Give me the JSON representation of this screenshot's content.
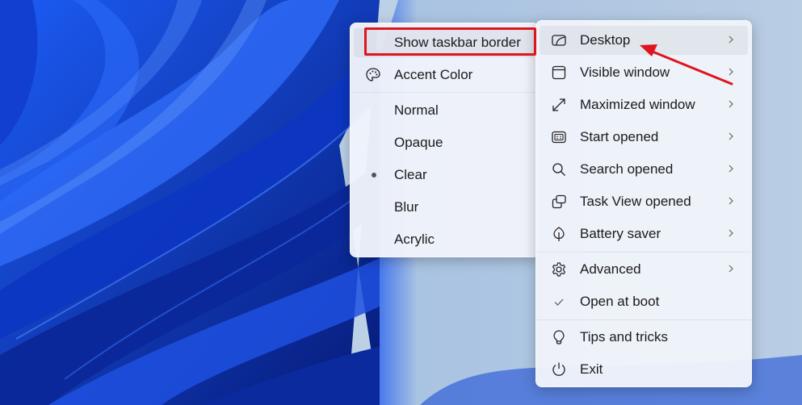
{
  "left_menu": {
    "items": [
      {
        "label": "Show taskbar border",
        "icon": "none",
        "highlighted": true
      },
      {
        "label": "Accent Color",
        "icon": "palette-icon"
      },
      {
        "label": "Normal"
      },
      {
        "label": "Opaque"
      },
      {
        "label": "Clear",
        "selected": true
      },
      {
        "label": "Blur"
      },
      {
        "label": "Acrylic"
      }
    ]
  },
  "right_menu": {
    "items": [
      {
        "label": "Desktop",
        "icon": "desktop-icon",
        "submenu": true,
        "hover": true
      },
      {
        "label": "Visible window",
        "icon": "window-icon",
        "submenu": true
      },
      {
        "label": "Maximized window",
        "icon": "maximize-icon",
        "submenu": true
      },
      {
        "label": "Start opened",
        "icon": "start-icon",
        "submenu": true
      },
      {
        "label": "Search opened",
        "icon": "search-icon",
        "submenu": true
      },
      {
        "label": "Task View opened",
        "icon": "task-view-icon",
        "submenu": true
      },
      {
        "label": "Battery saver",
        "icon": "leaf-icon",
        "submenu": true
      },
      {
        "label": "Advanced",
        "icon": "gear-icon",
        "submenu": true
      },
      {
        "label": "Open at boot",
        "icon": "check-icon",
        "checked": true
      },
      {
        "label": "Tips and tricks",
        "icon": "lightbulb-icon"
      },
      {
        "label": "Exit",
        "icon": "power-icon"
      }
    ]
  },
  "annotations": {
    "highlight_color": "#e0141e",
    "arrow_color": "#e0141e"
  }
}
